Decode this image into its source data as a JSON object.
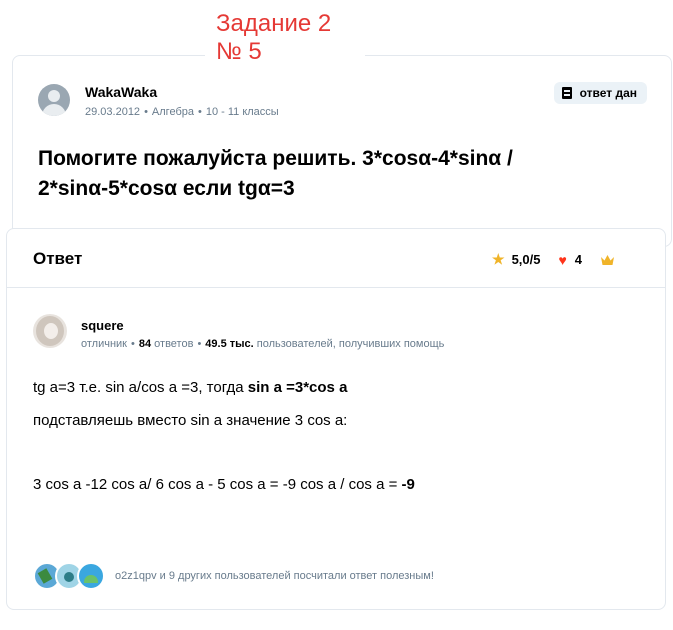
{
  "overlay": {
    "line1": "Задание 2",
    "line2": "№ 5"
  },
  "question": {
    "author": "WakaWaka",
    "date": "29.03.2012",
    "subject": "Алгебра",
    "grade": "10 - 11 классы",
    "badge": "ответ дан",
    "title_line1": "Помогите пожалуйста решить. 3*cosα-4*sinα /",
    "title_line2": "2*sinα-5*cosα если tgα=3"
  },
  "answer": {
    "header": "Ответ",
    "rating": "5,0/5",
    "likes": "4",
    "author": {
      "name": "squere",
      "rank": "отличник",
      "answers_count": "84",
      "answers_label": "ответов",
      "helped_count": "49.5 тыс.",
      "helped_label": "пользователей, получивших помощь"
    },
    "line1_prefix": "tg a=3 т.е. sin a/cos a =3, тогда ",
    "line1_bold": "sin a =3*cos a",
    "line2": "подставляешь вместо sin a значение 3 cos a:",
    "line3_prefix": "3 cos a -12 cos a/ 6 cos a - 5 cos a = -9 cos a / cos a = ",
    "line3_bold": "-9",
    "helpful_text": "o2z1qpv и 9 других пользователей посчитали ответ полезным!"
  },
  "colors": {
    "overlay_text": "#e53935",
    "star": "#f0b429",
    "heart": "#ff341a",
    "muted": "#687b8c",
    "border": "#e3e8ee",
    "badge_bg": "#ebf2f7"
  },
  "icons": [
    "default-avatar-icon",
    "answer-badge-icon",
    "star-icon",
    "heart-icon",
    "crown-icon"
  ]
}
